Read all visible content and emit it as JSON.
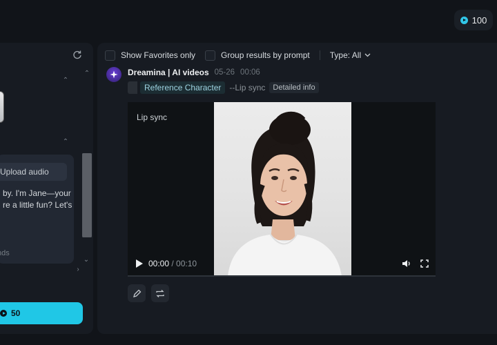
{
  "header": {
    "credits": "100"
  },
  "left_panel": {
    "upload_audio_label": "Upload audio",
    "script_text": "by. I'm Jane—your\nre a little fun? Let's",
    "duration_hint": "nds",
    "generate_cost": "50"
  },
  "toolbar": {
    "show_favorites_label": "Show Favorites only",
    "group_results_label": "Group results by prompt",
    "type_label": "Type: All"
  },
  "result": {
    "title": "Dreamina | AI videos",
    "date": "05-26",
    "time": "00:06",
    "tags": {
      "reference": "Reference Character",
      "mode": "--Lip sync",
      "details": "Detailed info"
    },
    "video": {
      "label": "Lip sync",
      "current_time": "00:00",
      "duration": "00:10",
      "separator": " / "
    }
  },
  "icons": {
    "credits": "play-circle-icon",
    "refresh": "refresh-icon",
    "edit": "pencil-icon",
    "regenerate": "repeat-icon"
  },
  "colors": {
    "accent": "#20c7e6",
    "background": "#111419",
    "panel": "#171b22"
  }
}
